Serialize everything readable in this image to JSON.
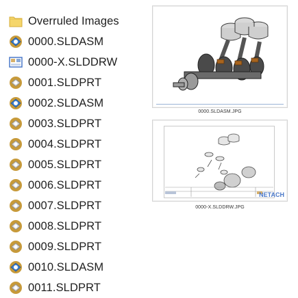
{
  "files": [
    {
      "name": "Overruled Images",
      "icon": "folder-icon"
    },
    {
      "name": "0000.SLDASM",
      "icon": "solidworks-assembly-icon"
    },
    {
      "name": "0000-X.SLDDRW",
      "icon": "solidworks-drawing-icon"
    },
    {
      "name": "0001.SLDPRT",
      "icon": "solidworks-part-icon"
    },
    {
      "name": "0002.SLDASM",
      "icon": "solidworks-assembly-icon"
    },
    {
      "name": "0003.SLDPRT",
      "icon": "solidworks-part-icon"
    },
    {
      "name": "0004.SLDPRT",
      "icon": "solidworks-part-icon"
    },
    {
      "name": "0005.SLDPRT",
      "icon": "solidworks-part-icon"
    },
    {
      "name": "0006.SLDPRT",
      "icon": "solidworks-part-icon"
    },
    {
      "name": "0007.SLDPRT",
      "icon": "solidworks-part-icon"
    },
    {
      "name": "0008.SLDPRT",
      "icon": "solidworks-part-icon"
    },
    {
      "name": "0009.SLDPRT",
      "icon": "solidworks-part-icon"
    },
    {
      "name": "0010.SLDASM",
      "icon": "solidworks-assembly-icon"
    },
    {
      "name": "0011.SLDPRT",
      "icon": "solidworks-part-icon"
    }
  ],
  "thumbnails": [
    {
      "caption": "0000.SLDASM.JPG",
      "image": "crankshaft-assembly-render"
    },
    {
      "caption": "0000-X.SLDDRW.JPG",
      "image": "exploded-drawing-sheet",
      "title_block_text": "NETACH"
    }
  ],
  "colors": {
    "folder": "#f5d66b",
    "part_gear": "#c79a3a",
    "assembly_blue": "#3c7fcf",
    "drawing_blue": "#4a78c8"
  }
}
